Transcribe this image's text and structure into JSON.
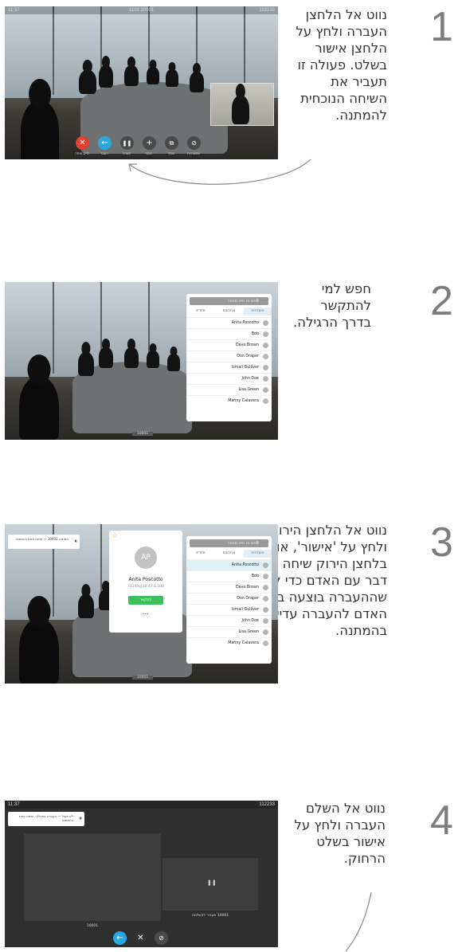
{
  "steps": [
    {
      "number": "1",
      "text": "נווט אל הלחצן העברה ולחץ על הלחצן אישור בשלט. פעולה זו תעביר את השיחה הנוכחית להמתנה."
    },
    {
      "number": "2",
      "text": "חפש למי להתקשר בדרך הרגילה."
    },
    {
      "number": "3",
      "text": "נווט אל הלחצן הירוק שיחה ולחץ על 'אישור', או השתמש בלחצן הירוק שיחה בשלט. דבר עם האדם כדי לוודא שההעברה בוצעה בהצלחה. האדם להעברה עדיין נמצא בהמתנה."
    },
    {
      "number": "4",
      "text": "נווט אל השלם העברה ולחץ על אישור בשלט הרחוק."
    }
  ],
  "screen1": {
    "time": "11:37",
    "center": "1103 10001",
    "right": "112233",
    "buttons": [
      {
        "icon": "end-call-icon",
        "label": "סיים שיחה",
        "color": "#e3402f"
      },
      {
        "icon": "transfer-icon",
        "label": "העבר",
        "color": "#2aa9e0"
      },
      {
        "icon": "hold-icon",
        "label": "השהה",
        "color": "#4a4a4a"
      },
      {
        "icon": "add-icon",
        "label": "הוסף",
        "color": "#4a4a4a"
      },
      {
        "icon": "share-icon",
        "label": "שתף",
        "color": "#4a4a4a"
      },
      {
        "icon": "more-icon",
        "label": "אפשרויות",
        "color": "#4a4a4a"
      }
    ]
  },
  "screen2": {
    "search_placeholder": "חפש או חייג מספר",
    "tabs": [
      "מועדפים",
      "אחרונים",
      "ספריה"
    ],
    "contacts": [
      "Anita Poscotto",
      "Bob",
      "Dave Brown",
      "Don Draper",
      "Ismail Gulliver",
      "John Doe",
      "Lisa Green",
      "Manny Calavera"
    ],
    "bottom_label": "10001"
  },
  "screen3": {
    "notice": "המתנה 10001 — שיחה אחת בהמתנה",
    "card_initials": "AP",
    "card_name": "Anita Poscotto",
    "card_number": "74149@10.47.6.109",
    "card_call": "התקשר",
    "card_more": "...",
    "contacts": [
      "Anita Poscotto",
      "Bob",
      "Dave Brown",
      "Don Draper",
      "Ismail Gulliver",
      "John Doe",
      "Lisa Green",
      "Manny Calavera"
    ],
    "bottom_label": "10001"
  },
  "screen4": {
    "time": "11:37",
    "right": "112233",
    "notice": "לא פעיל — העברה בתהליך, שיחה אחת בהמתנה",
    "big_tile_label": "10001",
    "small_tile_label": "10001 מעביר להשלמה",
    "buttons": [
      {
        "icon": "transfer-complete-icon",
        "color": "#2aa9e0"
      },
      {
        "icon": "end-call-icon",
        "color": "#333"
      },
      {
        "icon": "more-icon",
        "color": "#4a4a4a"
      }
    ]
  }
}
